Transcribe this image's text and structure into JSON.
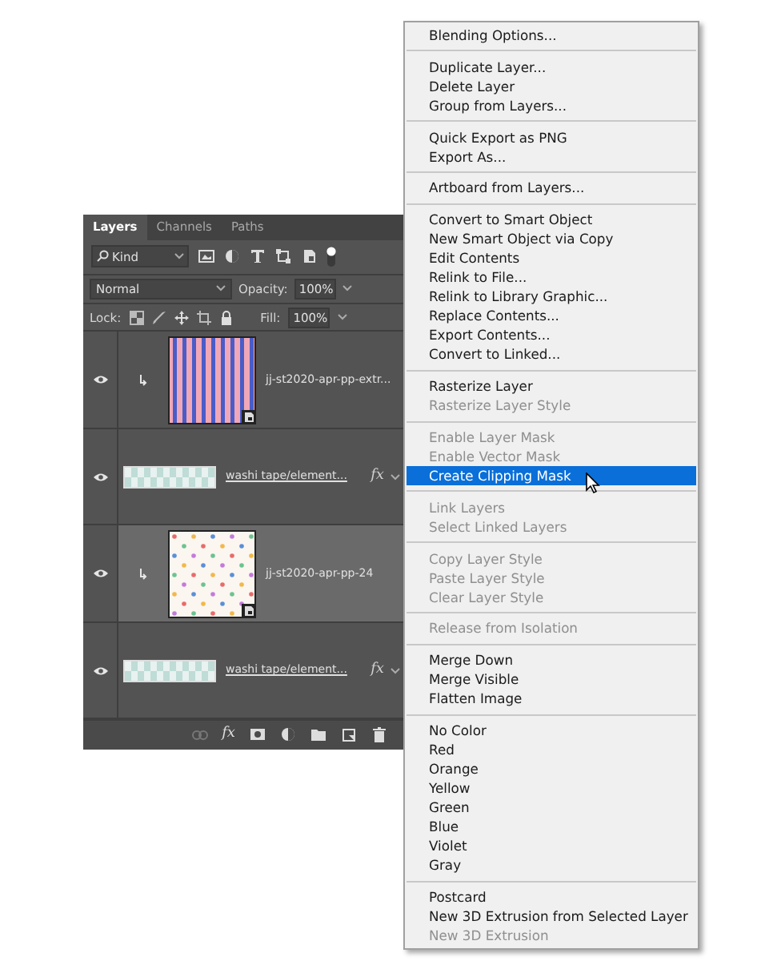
{
  "panel": {
    "tabs": [
      {
        "label": "Layers",
        "selected": true
      },
      {
        "label": "Channels",
        "selected": false
      },
      {
        "label": "Paths",
        "selected": false
      }
    ],
    "filter": {
      "value": "Kind"
    },
    "blend_mode": {
      "value": "Normal"
    },
    "opacity": {
      "label": "Opacity:",
      "value": "100%"
    },
    "lock": {
      "label": "Lock:"
    },
    "fill": {
      "label": "Fill:",
      "value": "100%"
    },
    "layers": [
      {
        "kind": "smart",
        "name": "jj-st2020-apr-pp-extr...",
        "visible": true,
        "clipped": true,
        "selected": false
      },
      {
        "kind": "shape",
        "name": "washi tape/element...",
        "visible": true,
        "fx": "fx",
        "selected": false
      },
      {
        "kind": "smart",
        "name": "jj-st2020-apr-pp-24",
        "visible": true,
        "clipped": true,
        "selected": true
      },
      {
        "kind": "shape",
        "name": "washi tape/element...",
        "visible": true,
        "fx": "fx",
        "selected": false
      }
    ],
    "footer": {
      "fx": "fx"
    }
  },
  "menu": {
    "groups": [
      [
        {
          "label": "Blending Options...",
          "disabled": false,
          "selected": false
        }
      ],
      [
        {
          "label": "Duplicate Layer...",
          "disabled": false,
          "selected": false
        },
        {
          "label": "Delete Layer",
          "disabled": false,
          "selected": false
        },
        {
          "label": "Group from Layers...",
          "disabled": false,
          "selected": false
        }
      ],
      [
        {
          "label": "Quick Export as PNG",
          "disabled": false,
          "selected": false
        },
        {
          "label": "Export As...",
          "disabled": false,
          "selected": false
        }
      ],
      [
        {
          "label": "Artboard from Layers...",
          "disabled": false,
          "selected": false
        }
      ],
      [
        {
          "label": "Convert to Smart Object",
          "disabled": false,
          "selected": false
        },
        {
          "label": "New Smart Object via Copy",
          "disabled": false,
          "selected": false
        },
        {
          "label": "Edit Contents",
          "disabled": false,
          "selected": false
        },
        {
          "label": "Relink to File...",
          "disabled": false,
          "selected": false
        },
        {
          "label": "Relink to Library Graphic...",
          "disabled": false,
          "selected": false
        },
        {
          "label": "Replace Contents...",
          "disabled": false,
          "selected": false
        },
        {
          "label": "Export Contents...",
          "disabled": false,
          "selected": false
        },
        {
          "label": "Convert to Linked...",
          "disabled": false,
          "selected": false
        }
      ],
      [
        {
          "label": "Rasterize Layer",
          "disabled": false,
          "selected": false
        },
        {
          "label": "Rasterize Layer Style",
          "disabled": true,
          "selected": false
        }
      ],
      [
        {
          "label": "Enable Layer Mask",
          "disabled": true,
          "selected": false
        },
        {
          "label": "Enable Vector Mask",
          "disabled": true,
          "selected": false
        },
        {
          "label": "Create Clipping Mask",
          "disabled": false,
          "selected": true
        }
      ],
      [
        {
          "label": "Link Layers",
          "disabled": true,
          "selected": false
        },
        {
          "label": "Select Linked Layers",
          "disabled": true,
          "selected": false
        }
      ],
      [
        {
          "label": "Copy Layer Style",
          "disabled": true,
          "selected": false
        },
        {
          "label": "Paste Layer Style",
          "disabled": true,
          "selected": false
        },
        {
          "label": "Clear Layer Style",
          "disabled": true,
          "selected": false
        }
      ],
      [
        {
          "label": "Release from Isolation",
          "disabled": true,
          "selected": false
        }
      ],
      [
        {
          "label": "Merge Down",
          "disabled": false,
          "selected": false
        },
        {
          "label": "Merge Visible",
          "disabled": false,
          "selected": false
        },
        {
          "label": "Flatten Image",
          "disabled": false,
          "selected": false
        }
      ],
      [
        {
          "label": "No Color",
          "disabled": false,
          "selected": false
        },
        {
          "label": "Red",
          "disabled": false,
          "selected": false
        },
        {
          "label": "Orange",
          "disabled": false,
          "selected": false
        },
        {
          "label": "Yellow",
          "disabled": false,
          "selected": false
        },
        {
          "label": "Green",
          "disabled": false,
          "selected": false
        },
        {
          "label": "Blue",
          "disabled": false,
          "selected": false
        },
        {
          "label": "Violet",
          "disabled": false,
          "selected": false
        },
        {
          "label": "Gray",
          "disabled": false,
          "selected": false
        }
      ],
      [
        {
          "label": "Postcard",
          "disabled": false,
          "selected": false
        },
        {
          "label": "New 3D Extrusion from Selected Layer",
          "disabled": false,
          "selected": false
        },
        {
          "label": "New 3D Extrusion",
          "disabled": true,
          "selected": false
        }
      ]
    ]
  }
}
